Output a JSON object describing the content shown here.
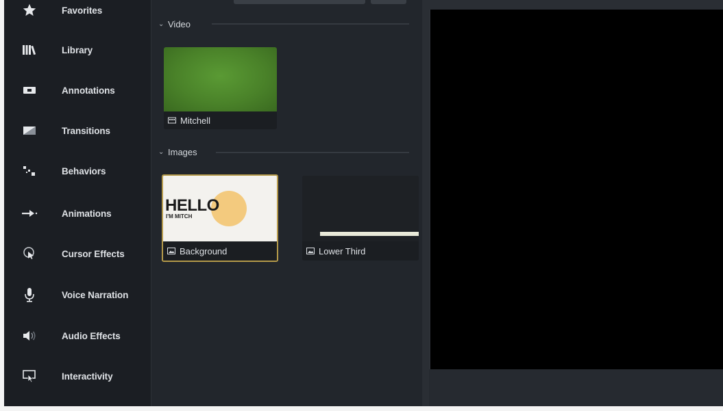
{
  "sidebar": {
    "items": [
      {
        "label": "Favorites",
        "icon": "star-icon"
      },
      {
        "label": "Library",
        "icon": "library-icon"
      },
      {
        "label": "Annotations",
        "icon": "annotations-icon"
      },
      {
        "label": "Transitions",
        "icon": "transitions-icon"
      },
      {
        "label": "Behaviors",
        "icon": "behaviors-icon"
      },
      {
        "label": "Animations",
        "icon": "animations-icon"
      },
      {
        "label": "Cursor Effects",
        "icon": "cursor-effects-icon"
      },
      {
        "label": "Voice Narration",
        "icon": "microphone-icon"
      },
      {
        "label": "Audio Effects",
        "icon": "speaker-icon"
      },
      {
        "label": "Interactivity",
        "icon": "interactivity-icon"
      }
    ]
  },
  "media": {
    "sections": [
      {
        "title": "Video",
        "toggle": "⌄",
        "items": [
          {
            "label": "Mitchell",
            "type_icon": "video-clip-icon"
          }
        ]
      },
      {
        "title": "Images",
        "toggle": "⌄",
        "items": [
          {
            "label": "Background",
            "type_icon": "image-icon",
            "selected": true,
            "preview_text_big": "HELLO",
            "preview_text_small": "I'M MITCH"
          },
          {
            "label": "Lower Third",
            "type_icon": "image-icon",
            "selected": false
          }
        ]
      }
    ]
  },
  "colors": {
    "sidebar_bg": "#1b1e23",
    "panel_bg": "#22262c",
    "canvas_bg": "#000000",
    "selection": "#b59a4a",
    "video_green": "#4f8a2e"
  }
}
